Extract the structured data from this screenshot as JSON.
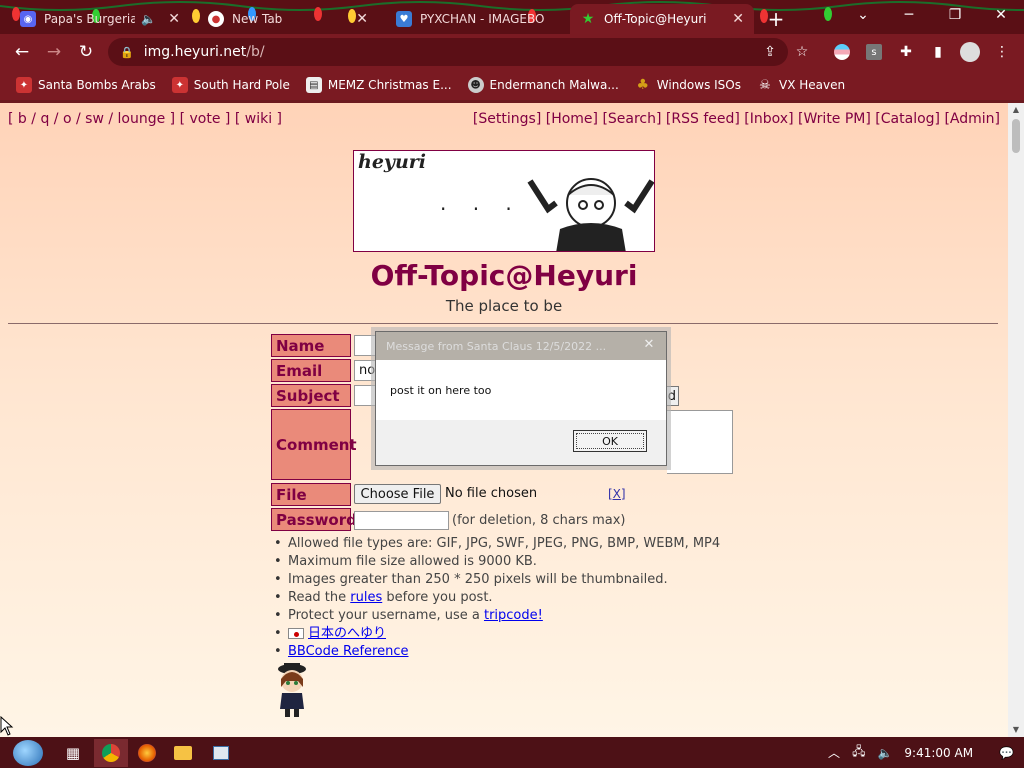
{
  "tabs": [
    {
      "title": "Papa's Burgeria | C",
      "icon": "headphones-icon",
      "active": false
    },
    {
      "title": "New Tab",
      "icon": "chrome-icon",
      "active": false
    },
    {
      "title": "PYXCHAN - IMAGEBO",
      "icon": "shield-icon",
      "active": false
    },
    {
      "title": "Off-Topic@Heyuri",
      "icon": "star-icon",
      "active": true
    }
  ],
  "address_bar": {
    "host": "img.heyuri.net",
    "path": "/b/"
  },
  "bookmarks": [
    {
      "label": "Santa Bombs Arabs"
    },
    {
      "label": "South Hard Pole"
    },
    {
      "label": "MEMZ Christmas E..."
    },
    {
      "label": "Endermanch Malwa..."
    },
    {
      "label": "Windows ISOs"
    },
    {
      "label": "VX Heaven"
    }
  ],
  "page": {
    "board_nav": {
      "b": "b",
      "q": "q",
      "o": "o",
      "sw": "sw",
      "lounge": "lounge",
      "vote": "vote",
      "wiki": "wiki"
    },
    "top_links": {
      "settings": "Settings",
      "home": "Home",
      "search": "Search",
      "rss": "RSS feed",
      "inbox": "Inbox",
      "write_pm": "Write PM",
      "catalog": "Catalog",
      "admin": "Admin"
    },
    "banner_text": "heyuri",
    "banner_dots": ". . .",
    "title": "Off-Topic@Heyuri",
    "subtitle": "The place to be",
    "form": {
      "name_label": "Name",
      "email_label": "Email",
      "email_value": "noko",
      "subject_label": "Subject",
      "submit_label": "Send",
      "comment_label": "Comment",
      "file_label": "File",
      "choose_file": "Choose File",
      "no_file": "No file chosen",
      "file_clear": "[X]",
      "password_label": "Password",
      "password_note": "(for deletion, 8 chars max)"
    },
    "rules": {
      "r1": "Allowed file types are: GIF, JPG, SWF, JPEG, PNG, BMP, WEBM, MP4",
      "r2": "Maximum file size allowed is 9000 KB.",
      "r3": "Images greater than 250 * 250 pixels will be thumbnailed.",
      "r4_pre": "Read the ",
      "r4_link": "rules",
      "r4_post": " before you post.",
      "r5_pre": "Protect your username, use a ",
      "r5_link": "tripcode!",
      "r6_link": "日本のへゆり",
      "r7_link": "BBCode Reference"
    }
  },
  "dialog": {
    "title": "Message from Santa Claus 12/5/2022 ...",
    "message": "post it on here too",
    "ok_label": "OK"
  },
  "taskbar": {
    "time": "9:41:00 AM"
  },
  "colors": {
    "accent": "#800043",
    "label_bg": "#ea8a7a",
    "chrome_frame": "#7a1a22"
  }
}
